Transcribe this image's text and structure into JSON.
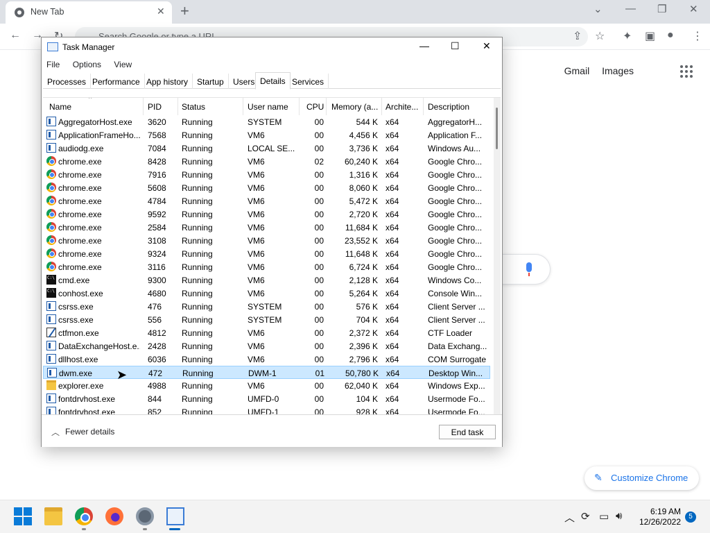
{
  "chrome": {
    "tab_title": "New Tab",
    "omnibox_placeholder": "Search Google or type a URL",
    "links": {
      "gmail": "Gmail",
      "images": "Images"
    },
    "customize_label": "Customize Chrome"
  },
  "taskmgr": {
    "title": "Task Manager",
    "menu": [
      "File",
      "Options",
      "View"
    ],
    "tabs": [
      "Processes",
      "Performance",
      "App history",
      "Startup",
      "Users",
      "Details",
      "Services"
    ],
    "active_tab": "Details",
    "columns": [
      "Name",
      "PID",
      "Status",
      "User name",
      "CPU",
      "Memory (a...",
      "Archite...",
      "Description"
    ],
    "rows": [
      {
        "name": "AggregatorHost.exe",
        "pid": "3620",
        "status": "Running",
        "user": "SYSTEM",
        "cpu": "00",
        "mem": "544 K",
        "arch": "x64",
        "desc": "AggregatorH...",
        "icon": "app-icon"
      },
      {
        "name": "ApplicationFrameHo...",
        "pid": "7568",
        "status": "Running",
        "user": "VM6",
        "cpu": "00",
        "mem": "4,456 K",
        "arch": "x64",
        "desc": "Application F...",
        "icon": "app-icon"
      },
      {
        "name": "audiodg.exe",
        "pid": "7084",
        "status": "Running",
        "user": "LOCAL SE...",
        "cpu": "00",
        "mem": "3,736 K",
        "arch": "x64",
        "desc": "Windows Au...",
        "icon": "app-icon"
      },
      {
        "name": "chrome.exe",
        "pid": "8428",
        "status": "Running",
        "user": "VM6",
        "cpu": "02",
        "mem": "60,240 K",
        "arch": "x64",
        "desc": "Google Chro...",
        "icon": "chrome-icon"
      },
      {
        "name": "chrome.exe",
        "pid": "7916",
        "status": "Running",
        "user": "VM6",
        "cpu": "00",
        "mem": "1,316 K",
        "arch": "x64",
        "desc": "Google Chro...",
        "icon": "chrome-icon"
      },
      {
        "name": "chrome.exe",
        "pid": "5608",
        "status": "Running",
        "user": "VM6",
        "cpu": "00",
        "mem": "8,060 K",
        "arch": "x64",
        "desc": "Google Chro...",
        "icon": "chrome-icon"
      },
      {
        "name": "chrome.exe",
        "pid": "4784",
        "status": "Running",
        "user": "VM6",
        "cpu": "00",
        "mem": "5,472 K",
        "arch": "x64",
        "desc": "Google Chro...",
        "icon": "chrome-icon"
      },
      {
        "name": "chrome.exe",
        "pid": "9592",
        "status": "Running",
        "user": "VM6",
        "cpu": "00",
        "mem": "2,720 K",
        "arch": "x64",
        "desc": "Google Chro...",
        "icon": "chrome-icon"
      },
      {
        "name": "chrome.exe",
        "pid": "2584",
        "status": "Running",
        "user": "VM6",
        "cpu": "00",
        "mem": "11,684 K",
        "arch": "x64",
        "desc": "Google Chro...",
        "icon": "chrome-icon"
      },
      {
        "name": "chrome.exe",
        "pid": "3108",
        "status": "Running",
        "user": "VM6",
        "cpu": "00",
        "mem": "23,552 K",
        "arch": "x64",
        "desc": "Google Chro...",
        "icon": "chrome-icon"
      },
      {
        "name": "chrome.exe",
        "pid": "9324",
        "status": "Running",
        "user": "VM6",
        "cpu": "00",
        "mem": "11,648 K",
        "arch": "x64",
        "desc": "Google Chro...",
        "icon": "chrome-icon"
      },
      {
        "name": "chrome.exe",
        "pid": "3116",
        "status": "Running",
        "user": "VM6",
        "cpu": "00",
        "mem": "6,724 K",
        "arch": "x64",
        "desc": "Google Chro...",
        "icon": "chrome-icon"
      },
      {
        "name": "cmd.exe",
        "pid": "9300",
        "status": "Running",
        "user": "VM6",
        "cpu": "00",
        "mem": "2,128 K",
        "arch": "x64",
        "desc": "Windows Co...",
        "icon": "cmd-icon"
      },
      {
        "name": "conhost.exe",
        "pid": "4680",
        "status": "Running",
        "user": "VM6",
        "cpu": "00",
        "mem": "5,264 K",
        "arch": "x64",
        "desc": "Console Win...",
        "icon": "cmd-icon"
      },
      {
        "name": "csrss.exe",
        "pid": "476",
        "status": "Running",
        "user": "SYSTEM",
        "cpu": "00",
        "mem": "576 K",
        "arch": "x64",
        "desc": "Client Server ...",
        "icon": "app-icon"
      },
      {
        "name": "csrss.exe",
        "pid": "556",
        "status": "Running",
        "user": "SYSTEM",
        "cpu": "00",
        "mem": "704 K",
        "arch": "x64",
        "desc": "Client Server ...",
        "icon": "app-icon"
      },
      {
        "name": "ctfmon.exe",
        "pid": "4812",
        "status": "Running",
        "user": "VM6",
        "cpu": "00",
        "mem": "2,372 K",
        "arch": "x64",
        "desc": "CTF Loader",
        "icon": "pen-icon"
      },
      {
        "name": "DataExchangeHost.e...",
        "pid": "2428",
        "status": "Running",
        "user": "VM6",
        "cpu": "00",
        "mem": "2,396 K",
        "arch": "x64",
        "desc": "Data Exchang...",
        "icon": "app-icon"
      },
      {
        "name": "dllhost.exe",
        "pid": "6036",
        "status": "Running",
        "user": "VM6",
        "cpu": "00",
        "mem": "2,796 K",
        "arch": "x64",
        "desc": "COM Surrogate",
        "icon": "app-icon"
      },
      {
        "name": "dwm.exe",
        "pid": "472",
        "status": "Running",
        "user": "DWM-1",
        "cpu": "01",
        "mem": "50,780 K",
        "arch": "x64",
        "desc": "Desktop Win...",
        "icon": "app-icon"
      },
      {
        "name": "explorer.exe",
        "pid": "4988",
        "status": "Running",
        "user": "VM6",
        "cpu": "00",
        "mem": "62,040 K",
        "arch": "x64",
        "desc": "Windows Exp...",
        "icon": "folder-icon"
      },
      {
        "name": "fontdrvhost.exe",
        "pid": "844",
        "status": "Running",
        "user": "UMFD-0",
        "cpu": "00",
        "mem": "104 K",
        "arch": "x64",
        "desc": "Usermode Fo...",
        "icon": "app-icon"
      },
      {
        "name": "fontdrvhost.exe",
        "pid": "852",
        "status": "Running",
        "user": "UMFD-1",
        "cpu": "00",
        "mem": "928 K",
        "arch": "x64",
        "desc": "Usermode Fo...",
        "icon": "app-icon"
      }
    ],
    "selected_row_index": 19,
    "fewer_details": "Fewer details",
    "end_task": "End task"
  },
  "taskbar": {
    "time": "6:19 AM",
    "date": "12/26/2022",
    "notification_count": "5"
  },
  "colors": {
    "selection_bg": "#cce8ff",
    "accent": "#0067c0",
    "chrome_blue": "#1a73e8"
  }
}
